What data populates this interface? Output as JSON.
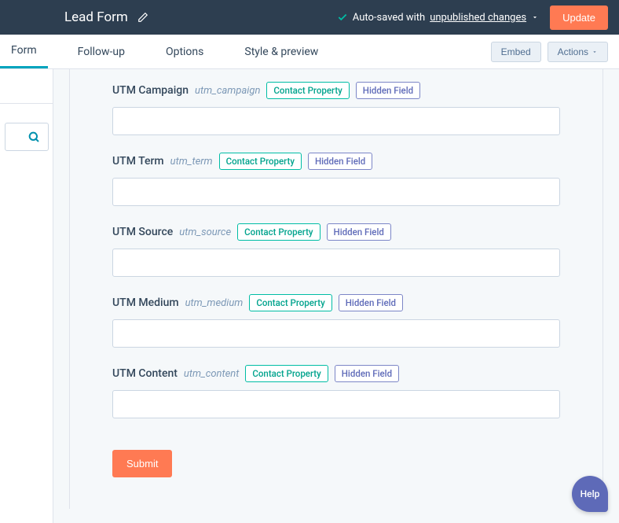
{
  "topbar": {
    "title": "Lead Form",
    "autosave_prefix": "Auto-saved with ",
    "autosave_link": "unpublished changes",
    "update_label": "Update"
  },
  "tabs": {
    "form": "Form",
    "followup": "Follow-up",
    "options": "Options",
    "style": "Style & preview",
    "embed": "Embed",
    "actions": "Actions"
  },
  "fields": [
    {
      "label": "UTM Campaign",
      "slug": "utm_campaign",
      "badge1": "Contact Property",
      "badge2": "Hidden Field",
      "value": ""
    },
    {
      "label": "UTM Term",
      "slug": "utm_term",
      "badge1": "Contact Property",
      "badge2": "Hidden Field",
      "value": ""
    },
    {
      "label": "UTM Source",
      "slug": "utm_source",
      "badge1": "Contact Property",
      "badge2": "Hidden Field",
      "value": ""
    },
    {
      "label": "UTM Medium",
      "slug": "utm_medium",
      "badge1": "Contact Property",
      "badge2": "Hidden Field",
      "value": ""
    },
    {
      "label": "UTM Content",
      "slug": "utm_content",
      "badge1": "Contact Property",
      "badge2": "Hidden Field",
      "value": ""
    }
  ],
  "submit_label": "Submit",
  "help_label": "Help"
}
